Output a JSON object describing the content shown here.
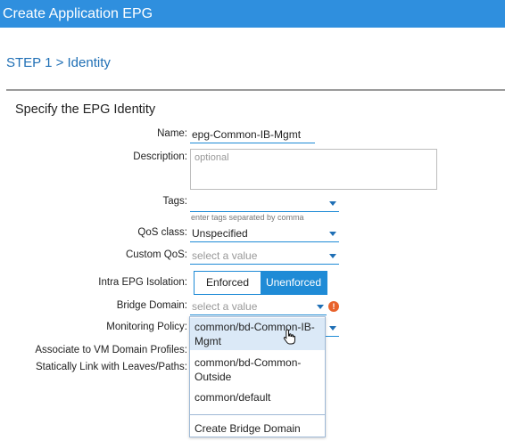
{
  "window": {
    "title": "Create Application EPG"
  },
  "wizard": {
    "step": "STEP 1 > Identity",
    "section_title": "Specify the EPG Identity"
  },
  "form": {
    "name": {
      "label": "Name:",
      "value": "epg-Common-IB-Mgmt"
    },
    "description": {
      "label": "Description:",
      "placeholder": "optional"
    },
    "tags": {
      "label": "Tags:",
      "hint": "enter tags separated by comma"
    },
    "qos_class": {
      "label": "QoS class:",
      "value": "Unspecified"
    },
    "custom_qos": {
      "label": "Custom QoS:",
      "placeholder": "select a value"
    },
    "intra_epg_isolation": {
      "label": "Intra EPG Isolation:",
      "options": [
        "Enforced",
        "Unenforced"
      ],
      "selected": "Unenforced"
    },
    "bridge_domain": {
      "label": "Bridge Domain:",
      "placeholder": "select a value"
    },
    "monitoring_policy": {
      "label": "Monitoring Policy:"
    },
    "vm_domain_profiles": {
      "label": "Associate to VM Domain Profiles:"
    },
    "static_link": {
      "label": "Statically Link with Leaves/Paths:"
    }
  },
  "bridge_domain_dropdown": {
    "options": [
      "common/bd-Common-IB-Mgmt",
      "common/bd-Common-Outside",
      "common/default"
    ],
    "highlighted": 0,
    "create_label": "Create Bridge Domain"
  },
  "colors": {
    "title_bar": "#2f8fde",
    "accent": "#1f8bd6",
    "step_text": "#1f6fb5",
    "error": "#e8622c",
    "highlight": "#dbe9f7"
  },
  "icons": {
    "error": "exclamation-circle",
    "dropdown": "caret-down",
    "cursor": "hand-pointer"
  }
}
